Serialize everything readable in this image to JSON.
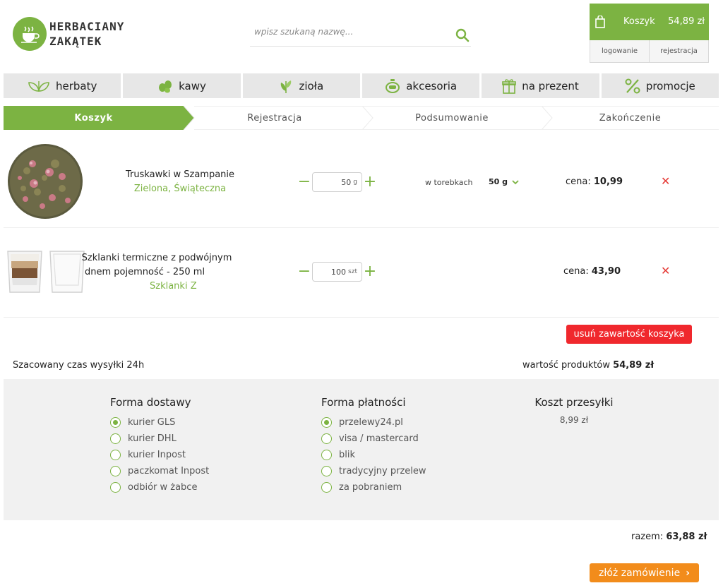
{
  "brand": {
    "line1": "HERBACIANY",
    "line2": "ZAKĄTEK"
  },
  "search": {
    "placeholder": "wpisz szukaną nazwę..."
  },
  "cart": {
    "label": "Koszyk",
    "total": "54,89 zł"
  },
  "auth": {
    "login": "logowanie",
    "register": "rejestracja"
  },
  "nav": [
    {
      "label": "herbaty",
      "icon": "tea-leaves-icon"
    },
    {
      "label": "kawy",
      "icon": "coffee-beans-icon"
    },
    {
      "label": "zioła",
      "icon": "herb-icon"
    },
    {
      "label": "akcesoria",
      "icon": "teapot-icon"
    },
    {
      "label": "na prezent",
      "icon": "gift-icon"
    },
    {
      "label": "promocje",
      "icon": "percent-icon"
    }
  ],
  "steps": [
    {
      "label": "Koszyk",
      "active": true
    },
    {
      "label": "Rejestracja",
      "active": false
    },
    {
      "label": "Podsumowanie",
      "active": false
    },
    {
      "label": "Zakończenie",
      "active": false
    }
  ],
  "items": [
    {
      "name": "Truskawki w Szampanie",
      "category": "Zielona, Świąteczna",
      "qty": "50",
      "unit": "g",
      "pack": "w torebkach",
      "size": "50 g",
      "price_label": "cena:",
      "price": "10,99",
      "remove": "✕"
    },
    {
      "name_line1": "Szklanki termiczne z podwójnym",
      "name_line2": "dnem pojemność - 250 ml",
      "category": "Szklanki Z",
      "qty": "100",
      "unit": "szt",
      "price_label": "cena:",
      "price": "43,90",
      "remove": "✕"
    }
  ],
  "clear_cart": "usuń zawartość koszyka",
  "shipping_time": "Szacowany czas wysyłki 24h",
  "products_value": {
    "label": "wartość produktów",
    "value": "54,89 zł"
  },
  "delivery": {
    "title": "Forma dostawy",
    "options": [
      "kurier GLS",
      "kurier DHL",
      "kurier Inpost",
      "paczkomat Inpost",
      "odbiór w żabce"
    ],
    "selected": 0
  },
  "payment": {
    "title": "Forma płatności",
    "options": [
      "przelewy24.pl",
      "visa / mastercard",
      "blik",
      "tradycyjny przelew",
      "za pobraniem"
    ],
    "selected": 0
  },
  "shipping_cost": {
    "title": "Koszt przesyłki",
    "value": "8,99 zł"
  },
  "total": {
    "label": "razem:",
    "value": "63,88 zł"
  },
  "order_button": "złóż zamówienie",
  "colors": {
    "accent": "#7cb342",
    "danger": "#f0282d",
    "order": "#f28c1b"
  }
}
